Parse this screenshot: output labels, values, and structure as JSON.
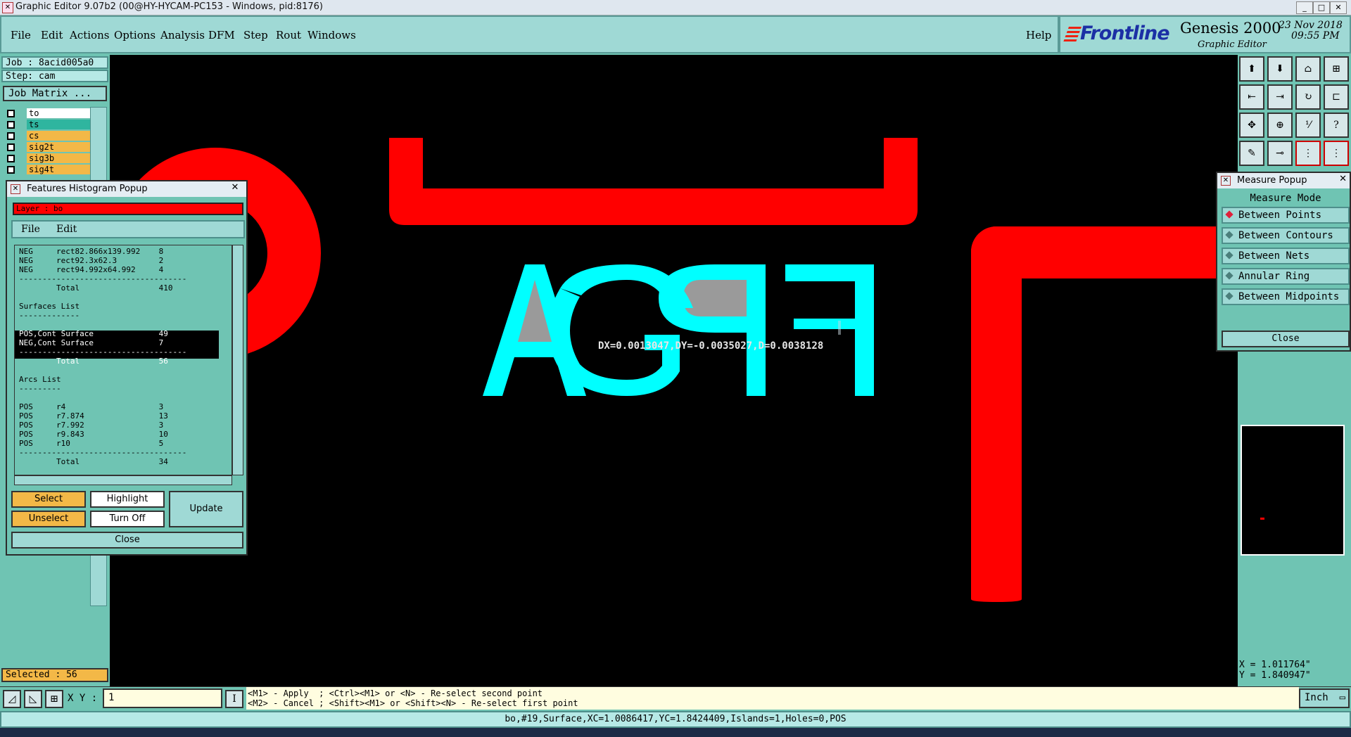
{
  "window": {
    "title": "Graphic Editor 9.07b2 (00@HY-HYCAM-PC153 - Windows, pid:8176)"
  },
  "menu": {
    "items": [
      "File",
      "Edit",
      "Actions",
      "Options",
      "Analysis",
      "DFM",
      "Step",
      "Rout",
      "Windows"
    ],
    "help": "Help"
  },
  "brand": {
    "logo": "Frontline",
    "product": "Genesis 2000",
    "subtitle": "Graphic Editor",
    "date": "23 Nov 2018",
    "time": "09:55 PM"
  },
  "job": {
    "job_label": "Job : 8acid005a0",
    "step_label": "Step: cam",
    "matrix_button": "Job Matrix ..."
  },
  "layers": [
    {
      "name": "to",
      "color": "#ffffff"
    },
    {
      "name": "ts",
      "color": "#2fb59f"
    },
    {
      "name": "cs",
      "color": "#f3b847"
    },
    {
      "name": "sig2t",
      "color": "#f3b847"
    },
    {
      "name": "sig3b",
      "color": "#f3b847"
    },
    {
      "name": "sig4t",
      "color": "#f3b847"
    }
  ],
  "histogram": {
    "title": "Features Histogram Popup",
    "layer_label": "Layer :  bo",
    "menu": [
      "File",
      "Edit"
    ],
    "lines": [
      "NEG     rect82.866x139.992    8",
      "NEG     rect92.3x62.3         2",
      "NEG     rect94.992x64.992     4",
      "------------------------------------",
      "        Total                 410",
      "",
      "Surfaces List",
      "-------------",
      "",
      "POS,Cont Surface              49",
      "NEG,Cont Surface              7",
      "------------------------------------",
      "        Total                 56",
      "",
      "Arcs List",
      "---------",
      "",
      "POS     r4                    3",
      "POS     r7.874                13",
      "POS     r7.992                3",
      "POS     r9.843                10",
      "POS     r10                   5",
      "------------------------------------",
      "        Total                 34"
    ],
    "buttons": {
      "select": "Select",
      "highlight": "Highlight",
      "unselect": "Unselect",
      "turn_off": "Turn Off",
      "update": "Update",
      "close": "Close"
    }
  },
  "canvas": {
    "text": "FPGA",
    "measure_readout": "DX=0.0013047,DY=-0.0035027,D=0.0038128"
  },
  "measure": {
    "title": "Measure Popup",
    "mode_label": "Measure Mode",
    "modes": [
      "Between Points",
      "Between Contours",
      "Between Nets",
      "Annular Ring",
      "Between Midpoints"
    ],
    "selected": "Between Points",
    "close": "Close"
  },
  "coords": {
    "x": "X = 1.011764\"",
    "y": "Y = 1.840947\""
  },
  "bottom": {
    "selected": "Selected : 56",
    "xy_label": "X Y :",
    "xy_value": "1",
    "hint1": "<M1> - Apply  ; <Ctrl><M1> or <N> - Re-select second point",
    "hint2": "<M2> - Cancel ; <Shift><M1> or <Shift><N> - Re-select first point",
    "units": "Inch",
    "status": "bo,#19,Surface,XC=1.0086417,YC=1.8424409,Islands=1,Holes=0,POS"
  },
  "colors": {
    "panel": "#6fc4b3",
    "menubar": "#9fd9d5",
    "canvas": "#000000",
    "red": "#ff0000",
    "cyan": "#00ffff",
    "button_yellow": "#f3b847"
  }
}
